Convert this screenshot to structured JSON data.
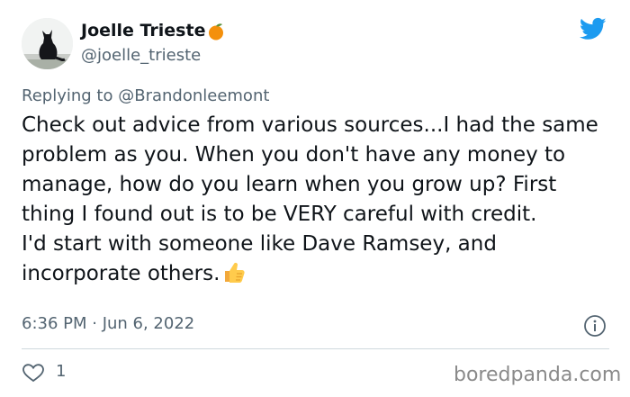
{
  "author": {
    "name": "Joelle Trieste",
    "handle": "@joelle_trieste",
    "name_emoji": "orange-emoji",
    "avatar": "black-cat-photo"
  },
  "platform_icon": "twitter-bird-icon",
  "reply": {
    "prefix": "Replying to",
    "mention": "@Brandonleemont"
  },
  "tweet": {
    "text_main": "Check out advice from various sources...I had the same problem as you. When you don't have any money to manage, how do you learn when you grow up? First thing I found out is to be VERY careful with credit.",
    "text_second": "I'd start with someone like Dave Ramsey, and incorporate others.",
    "trailing_emoji": "thumbs-up-emoji"
  },
  "meta": {
    "timestamp": "6:36 PM · Jun 6, 2022",
    "info_icon": "info-icon"
  },
  "actions": {
    "like_icon": "heart-icon",
    "like_count": "1"
  },
  "watermark": "boredpanda.com",
  "colors": {
    "primary_text": "#0f1419",
    "secondary_text": "#536471",
    "twitter_blue": "#1d9bf0",
    "divider": "#cfd9de"
  }
}
